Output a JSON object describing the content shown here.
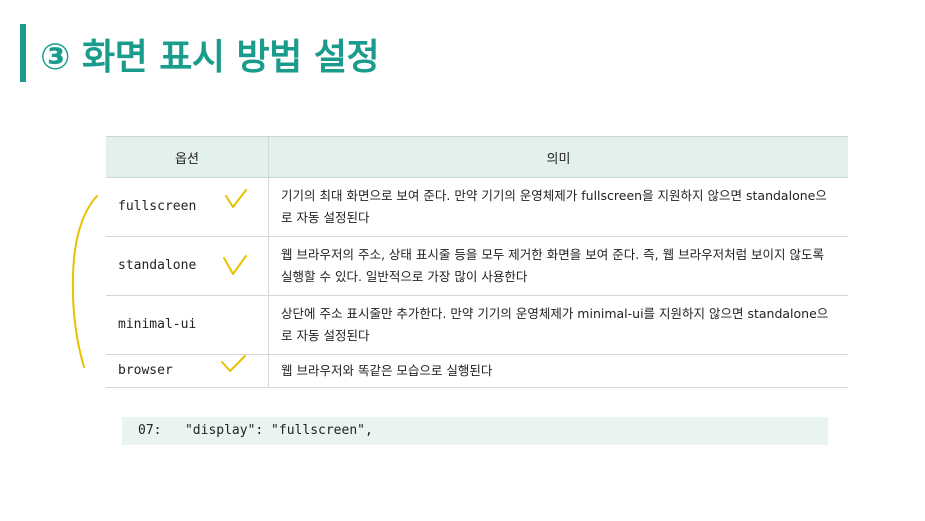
{
  "title": "③ 화면 표시 방법 설정",
  "table": {
    "headers": [
      "옵션",
      "의미"
    ],
    "rows": [
      {
        "option": "fullscreen",
        "meaning": "기기의 최대 화면으로 보여 준다. 만약 기기의 운영체제가 fullscreen을 지원하지 않으면 standalone으로 자동 설정된다"
      },
      {
        "option": "standalone",
        "meaning": "웹 브라우저의 주소, 상태 표시줄 등을 모두 제거한 화면을 보여 준다. 즉, 웹 브라우저처럼 보이지 않도록 실행할 수 있다. 일반적으로 가장 많이 사용한다"
      },
      {
        "option": "minimal-ui",
        "meaning": "상단에 주소 표시줄만 추가한다. 만약 기기의 운영체제가 minimal-ui를 지원하지 않으면 standalone으로 자동 설정된다"
      },
      {
        "option": "browser",
        "meaning": "웹 브라우저와 똑같은 모습으로 실행된다"
      }
    ]
  },
  "code": {
    "line_no": "07:",
    "text": "\"display\": \"fullscreen\","
  },
  "colors": {
    "accent": "#1a9c8c",
    "header_bg": "#e2f1ed",
    "code_bg": "#e9f4f1",
    "annotation": "#e6c200"
  }
}
